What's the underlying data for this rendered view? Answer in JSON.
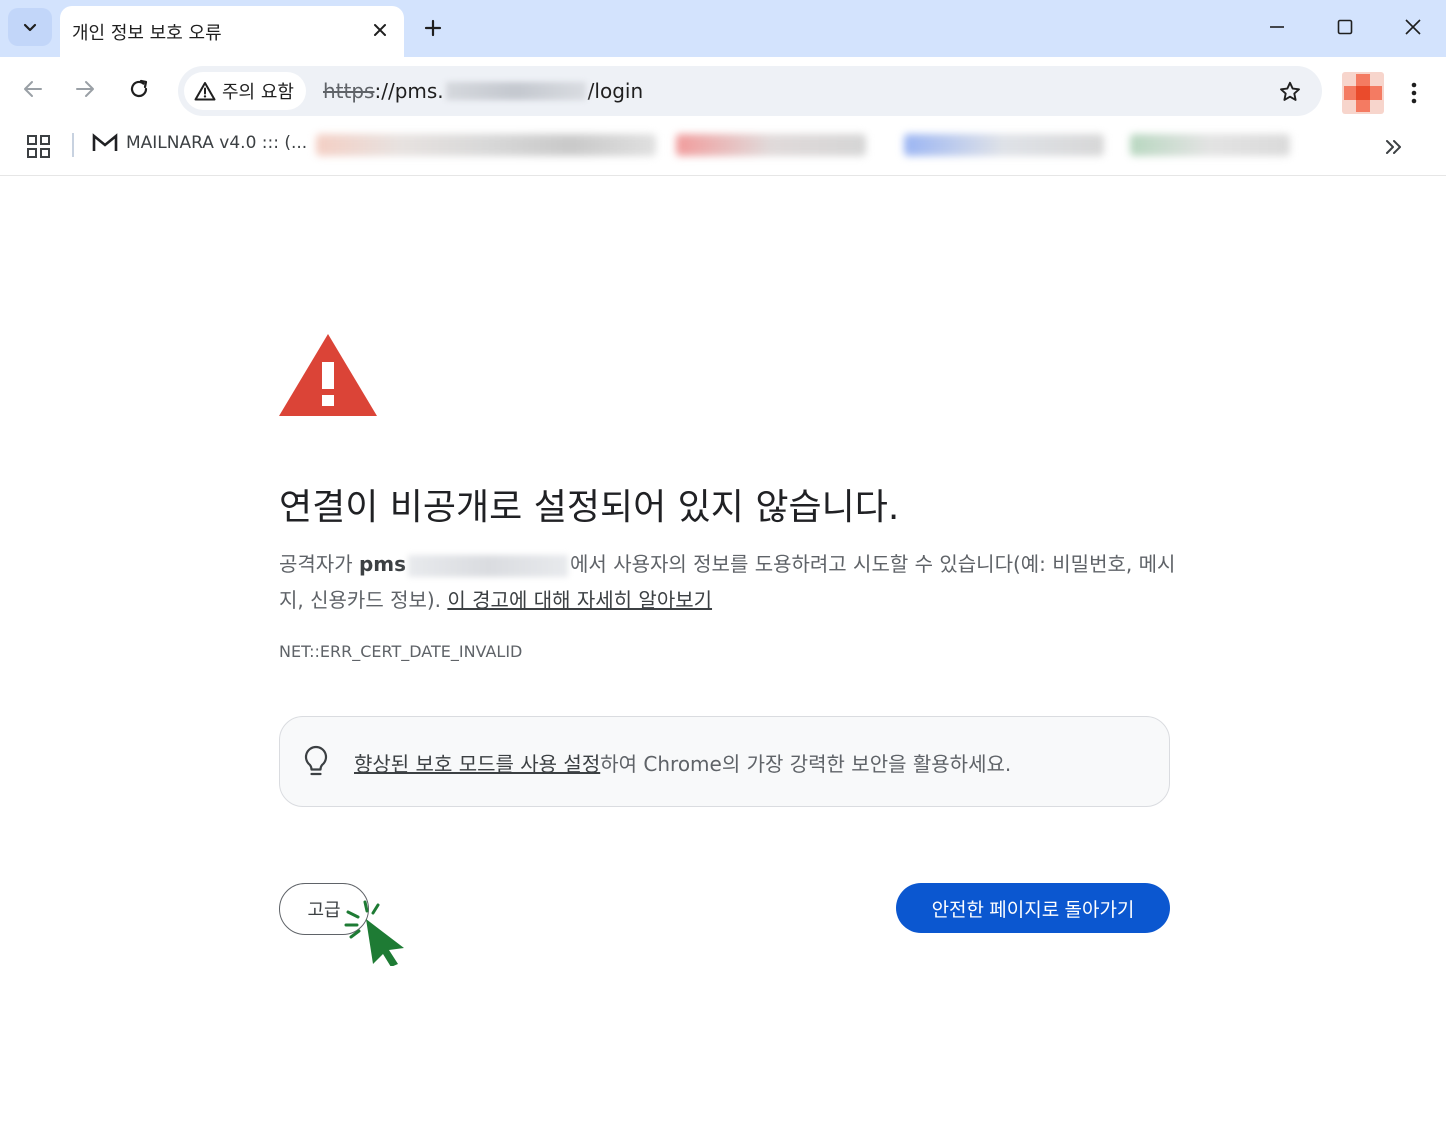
{
  "browser": {
    "tab_title": "개인 정보 보호 오류",
    "omnibox": {
      "chip_label": "주의 요함",
      "url_scheme": "https",
      "url_host_start": "://pms.",
      "url_path": "/login"
    },
    "bookmarks": {
      "item_label": "MAILNARA v4.0 ::: (..."
    }
  },
  "interstitial": {
    "heading": "연결이 비공개로 설정되어 있지 않습니다.",
    "explanation_prefix": "공격자가 ",
    "explanation_host": "pms",
    "explanation_body": "에서 사용자의 정보를 도용하려고 시도할 수 있습니다(예: 비밀번호, 메시지, 신용카드 정보). ",
    "learn_more_link": "이 경고에 대해 자세히 알아보기",
    "error_code": "NET::ERR_CERT_DATE_INVALID",
    "tip": {
      "link_text": "향상된 보호 모드를 사용 설정",
      "rest_text": "하여 Chrome의 가장 강력한 보안을 활용하세요."
    },
    "advanced_button": "고급",
    "back_button": "안전한 페이지로 돌아가기"
  },
  "colors": {
    "warning_red": "#db4437",
    "primary_blue": "#0b57d0",
    "cursor_green": "#1e7b34"
  }
}
